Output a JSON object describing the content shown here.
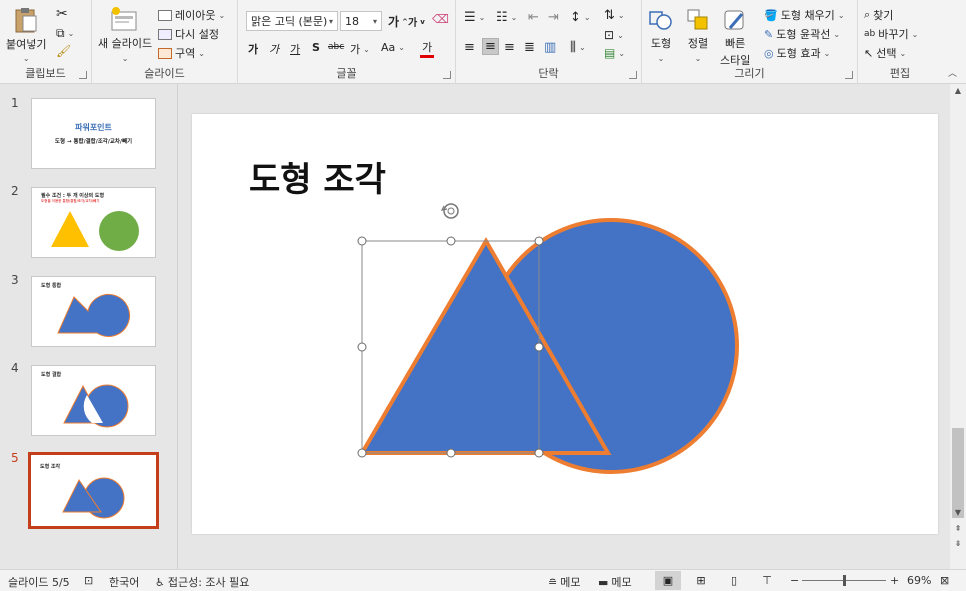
{
  "ribbon": {
    "clipboard": {
      "paste": "붙여넣기",
      "label": "클립보드"
    },
    "slides": {
      "new_slide": "새 슬라이드",
      "layout": "레이아웃",
      "reset": "다시 설정",
      "section": "구역",
      "label": "슬라이드"
    },
    "font": {
      "font_name": "맑은 고딕 (본문)",
      "font_size": "18",
      "bold": "가",
      "italic": "가",
      "underline": "가",
      "shadow": "S",
      "strike": "abc",
      "spacing": "가",
      "case": "Aa",
      "color": "가",
      "grow": "가",
      "shrink": "가",
      "label": "글꼴"
    },
    "paragraph": {
      "label": "단락"
    },
    "drawing": {
      "shapes": "도형",
      "arrange": "정렬",
      "quick_styles_1": "빠른",
      "quick_styles_2": "스타일",
      "fill": "도형 채우기",
      "outline": "도형 윤곽선",
      "effects": "도형 효과",
      "label": "그리기"
    },
    "editing": {
      "find": "찾기",
      "replace": "바꾸기",
      "select": "선택",
      "label": "편집"
    }
  },
  "thumbnails": [
    {
      "num": "1",
      "title": "파워포인트",
      "subtitle": "도형 → 통합/결합/조각/교차/빼기"
    },
    {
      "num": "2",
      "title": "필수 조건 : 두 개 이상의 도형",
      "subtitle": "도형을 이용한 통합/결합/조각/교차/빼기"
    },
    {
      "num": "3",
      "title": "도형 통합"
    },
    {
      "num": "4",
      "title": "도형 결합"
    },
    {
      "num": "5",
      "title": "도형 조각"
    }
  ],
  "slide": {
    "title": "도형 조각"
  },
  "colors": {
    "shape_fill": "#4472c4",
    "shape_outline": "#ed7d31",
    "triangle_yellow": "#ffc000",
    "circle_green": "#70ad47",
    "active_accent": "#c43e1c"
  },
  "status": {
    "slide_info": "슬라이드 5/5",
    "language": "한국어",
    "accessibility": "접근성: 조사 필요",
    "notes": "메모",
    "comments": "메모",
    "zoom": "69%"
  }
}
